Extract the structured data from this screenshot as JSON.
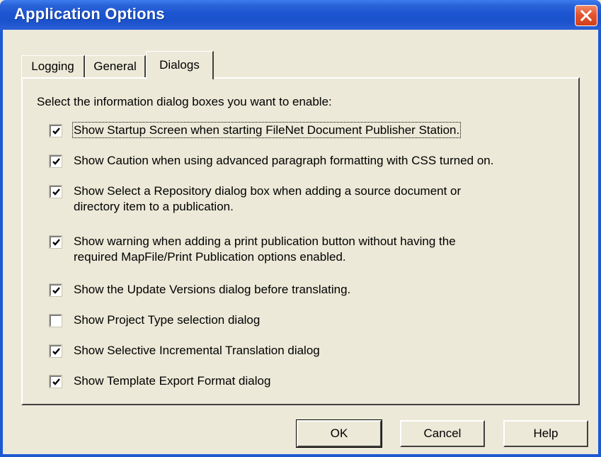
{
  "window": {
    "title": "Application Options"
  },
  "tabs": [
    {
      "label": "Logging",
      "active": false
    },
    {
      "label": "General",
      "active": false
    },
    {
      "label": "Dialogs",
      "active": true
    }
  ],
  "panel": {
    "instructions": "Select the information dialog boxes you want to enable:",
    "options": [
      {
        "checked": true,
        "lines": [
          "Show Startup Screen when starting FileNet Document Publisher Station."
        ]
      },
      {
        "checked": true,
        "lines": [
          "Show Caution when using advanced paragraph formatting with CSS turned on."
        ]
      },
      {
        "checked": true,
        "lines": [
          "Show Select a Repository dialog box when adding a source document or",
          "directory item to a publication."
        ]
      },
      {
        "checked": true,
        "lines": [
          "Show warning when adding a print publication button without having the",
          "required MapFile/Print Publication options enabled."
        ]
      },
      {
        "checked": true,
        "lines": [
          "Show the Update Versions dialog before translating."
        ]
      },
      {
        "checked": false,
        "lines": [
          "Show Project Type selection dialog"
        ]
      },
      {
        "checked": true,
        "lines": [
          "Show Selective Incremental Translation dialog"
        ]
      },
      {
        "checked": true,
        "lines": [
          "Show Template Export Format dialog"
        ]
      }
    ]
  },
  "buttons": {
    "ok": "OK",
    "cancel": "Cancel",
    "help": "Help"
  },
  "colors": {
    "titlebar": "#1c55d2",
    "dialog_bg": "#ece9d8",
    "close_button": "#e2552f"
  },
  "icons": {
    "close": "close-x-icon",
    "checkbox_mark": "checkmark-icon"
  }
}
